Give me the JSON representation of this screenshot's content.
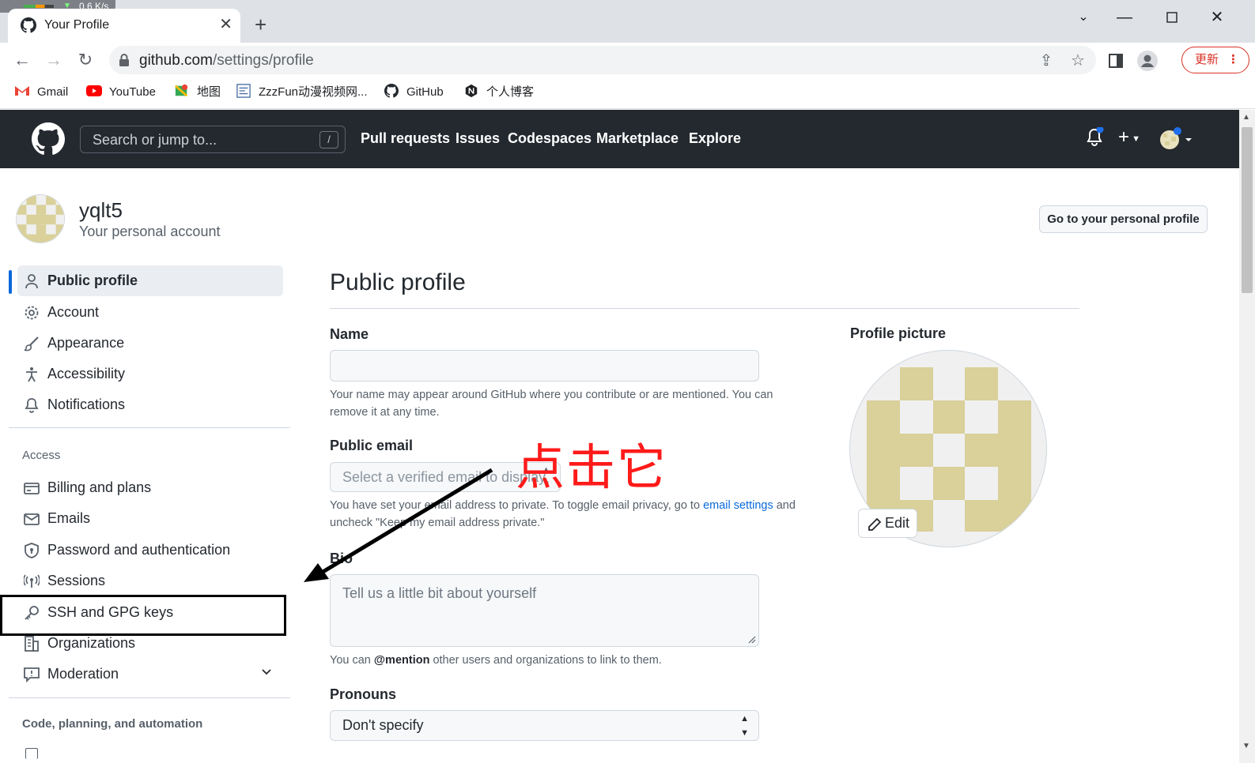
{
  "browser": {
    "net_speed": "0.6 K/s",
    "tab_title": "Your Profile",
    "url_host": "github.com",
    "url_path": "/settings/profile",
    "update_label": "更新"
  },
  "bookmarks": [
    {
      "label": "Gmail",
      "icon": "gmail-icon"
    },
    {
      "label": "YouTube",
      "icon": "youtube-icon"
    },
    {
      "label": "地图",
      "icon": "maps-icon"
    },
    {
      "label": "ZzzFun动漫视频网...",
      "icon": "zzzfun-icon"
    },
    {
      "label": "GitHub",
      "icon": "github-icon"
    },
    {
      "label": "个人博客",
      "icon": "blog-icon"
    }
  ],
  "github_header": {
    "search_placeholder": "Search or jump to...",
    "search_shortcut": "/",
    "nav": [
      "Pull requests",
      "Issues",
      "Codespaces",
      "Marketplace",
      "Explore"
    ]
  },
  "account": {
    "username": "yqlt5",
    "subtitle": "Your personal account",
    "go_profile_button": "Go to your personal profile"
  },
  "sidebar": {
    "items": [
      {
        "label": "Public profile",
        "icon": "person-icon",
        "active": true
      },
      {
        "label": "Account",
        "icon": "gear-icon"
      },
      {
        "label": "Appearance",
        "icon": "paintbrush-icon"
      },
      {
        "label": "Accessibility",
        "icon": "accessibility-icon"
      },
      {
        "label": "Notifications",
        "icon": "bell-icon"
      }
    ],
    "access_heading": "Access",
    "access_items": [
      {
        "label": "Billing and plans",
        "icon": "credit-card-icon"
      },
      {
        "label": "Emails",
        "icon": "mail-icon"
      },
      {
        "label": "Password and authentication",
        "icon": "shield-icon"
      },
      {
        "label": "Sessions",
        "icon": "broadcast-icon"
      },
      {
        "label": "SSH and GPG keys",
        "icon": "key-icon"
      },
      {
        "label": "Organizations",
        "icon": "organization-icon"
      },
      {
        "label": "Moderation",
        "icon": "report-icon"
      }
    ],
    "code_heading": "Code, planning, and automation"
  },
  "profile_form": {
    "title": "Public profile",
    "name_label": "Name",
    "name_value": "",
    "name_hint": "Your name may appear around GitHub where you contribute or are mentioned. You can remove it at any time.",
    "email_label": "Public email",
    "email_select": "Select a verified email to display",
    "email_hint_pre": "You have set your email address to private. To toggle email privacy, go to ",
    "email_hint_link": "email settings",
    "email_hint_post": " and uncheck \"Keep my email address private.\"",
    "bio_label": "Bio",
    "bio_placeholder": "Tell us a little bit about yourself",
    "bio_hint_pre": "You can ",
    "bio_hint_mention": "@mention",
    "bio_hint_post": " other users and organizations to link to them.",
    "pronouns_label": "Pronouns",
    "pronouns_value": "Don't specify",
    "picture_label": "Profile picture",
    "edit_button": "Edit"
  },
  "annotation": {
    "text": "点击它"
  },
  "colors": {
    "header_bg": "#24292f",
    "accent": "#0969da",
    "annotation_red": "#ff1a1a",
    "identicon": "#d9d09a"
  }
}
